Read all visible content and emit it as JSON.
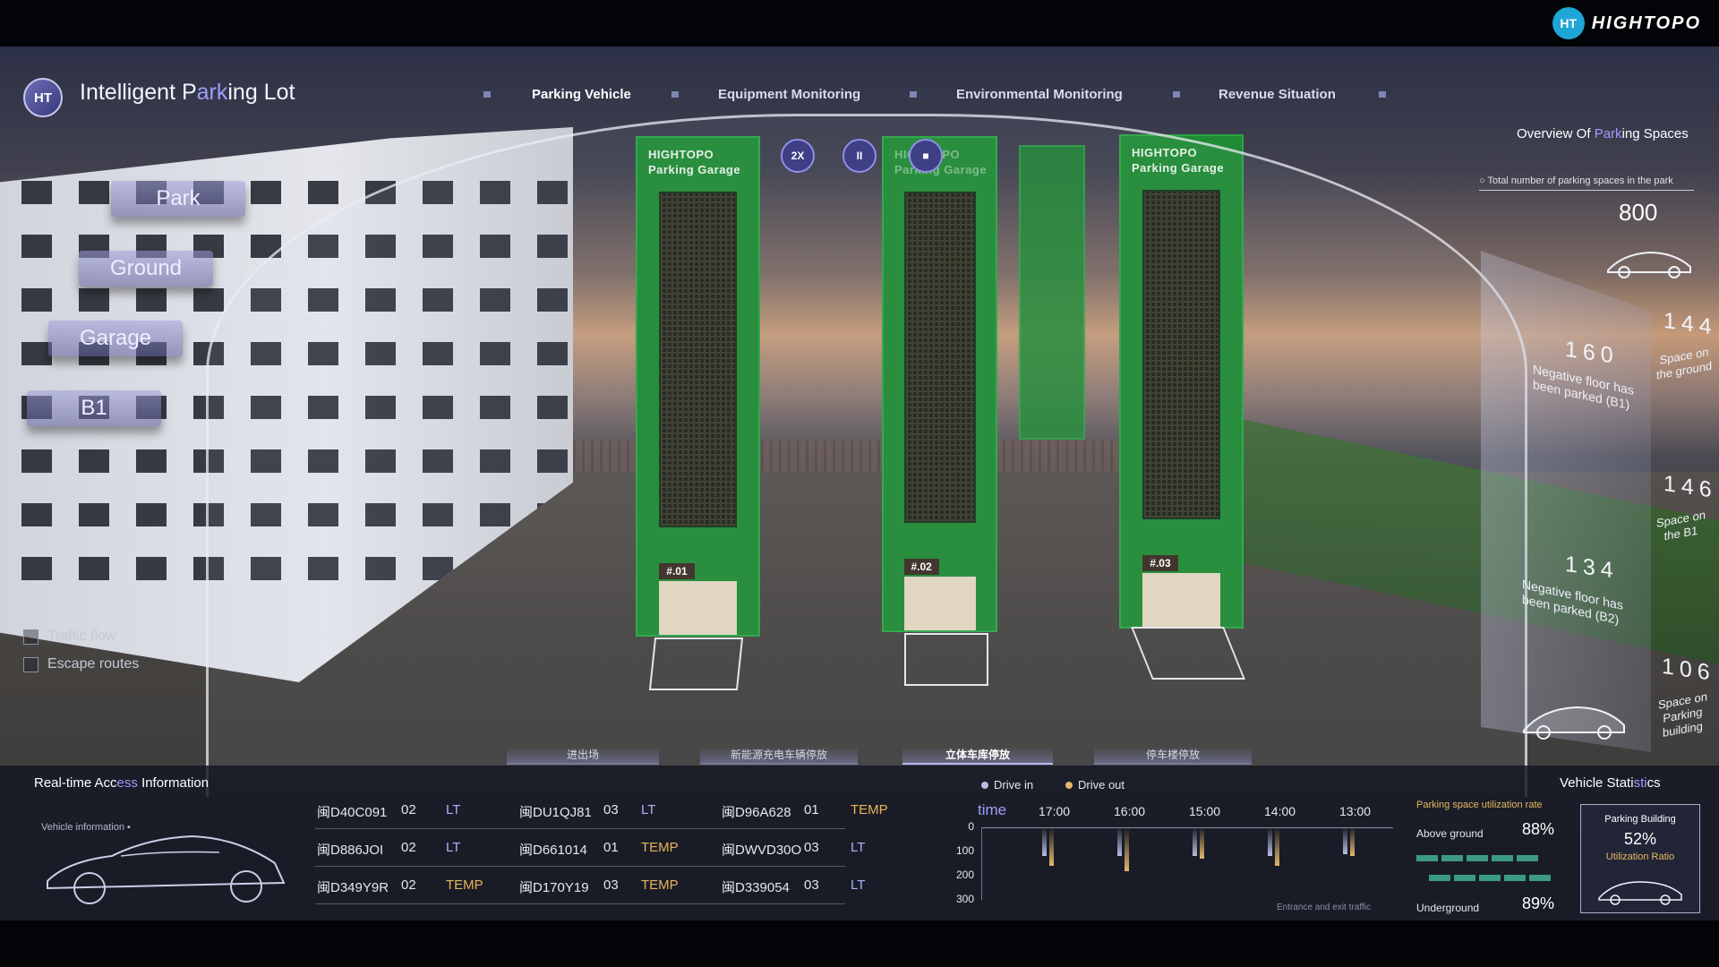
{
  "brand": {
    "name": "HIGHTOPO",
    "mark": "HT"
  },
  "app": {
    "logo": "HT",
    "title_pre": "Intelligent P",
    "title_hl": "ark",
    "title_post": "ing Lot"
  },
  "nav": [
    "Parking Vehicle",
    "Equipment Monitoring",
    "Environmental Monitoring",
    "Revenue Situation"
  ],
  "floors": [
    "Park",
    "Ground",
    "Garage",
    "B1"
  ],
  "checkboxes": [
    "Traffic flow",
    "Escape routes"
  ],
  "controls": [
    "2X",
    "II",
    "■"
  ],
  "towers": [
    {
      "name": "HIGHTOPO\nParking Garage",
      "num": "#.01"
    },
    {
      "name": "HIGHTOPO\nParking Garage",
      "num": "#.02"
    },
    {
      "name": "HIGHTOPO\nParking Garage",
      "num": "#.03"
    }
  ],
  "overview": {
    "title_pre": "Overview Of ",
    "title_hl": "Park",
    "title_post": "ing Spaces",
    "subtitle": "Total number of parking spaces in the park",
    "total": "800",
    "items": [
      {
        "value": "144",
        "label": "Space on\nthe ground"
      },
      {
        "value": "160",
        "label": "Negative floor has\nbeen parked (B1)"
      },
      {
        "value": "146",
        "label": "Space on\nthe B1"
      },
      {
        "value": "134",
        "label": "Negative floor has\nbeen parked (B2)"
      },
      {
        "value": "106",
        "label": "Space on\nParking\nbuilding"
      }
    ]
  },
  "bottom_tabs": [
    "进出场",
    "新能源充电车辆停放",
    "立体车库停放",
    "停车楼停放"
  ],
  "access": {
    "title_pre": "Real-time Acc",
    "title_hl": "ess",
    "title_post": " Information",
    "vehicle_info": "Vehicle information",
    "records": [
      [
        [
          "闽D40C091",
          "02",
          "LT"
        ],
        [
          "闽DU1QJ81",
          "03",
          "LT"
        ],
        [
          "闽D96A628",
          "01",
          "TEMP"
        ]
      ],
      [
        [
          "闽D886JOI",
          "02",
          "LT"
        ],
        [
          "闽D661014",
          "01",
          "TEMP"
        ],
        [
          "闽DWVD30O",
          "03",
          "LT"
        ]
      ],
      [
        [
          "闽D349Y9R",
          "02",
          "TEMP"
        ],
        [
          "闽D170Y19",
          "03",
          "TEMP"
        ],
        [
          "闽D339054",
          "03",
          "LT"
        ]
      ]
    ]
  },
  "chart_data": {
    "type": "bar",
    "legend": [
      "Drive in",
      "Drive out"
    ],
    "colors": {
      "drive_in": "#b8bde0",
      "drive_out": "#e2b86a"
    },
    "xlabel": "time",
    "categories": [
      "17:00",
      "16:00",
      "15:00",
      "14:00",
      "13:00"
    ],
    "y_ticks": [
      "0",
      "100",
      "200",
      "300"
    ],
    "ylim": [
      0,
      300
    ],
    "series": [
      {
        "name": "Drive in",
        "values": [
          120,
          120,
          120,
          120,
          110
        ]
      },
      {
        "name": "Drive out",
        "values": [
          160,
          180,
          130,
          160,
          120
        ]
      }
    ],
    "caption": "Entrance and exit traffic"
  },
  "vehicle_stats": {
    "title_pre": "Vehicle Stati",
    "title_hl": "sti",
    "title_post": "cs",
    "util_title": "Parking space utilization rate",
    "above_label": "Above ground",
    "above_value": "88%",
    "under_label": "Underground",
    "under_value": "89%",
    "building_label": "Parking Building",
    "building_value": "52%",
    "building_sub": "Utilization Ratio"
  }
}
